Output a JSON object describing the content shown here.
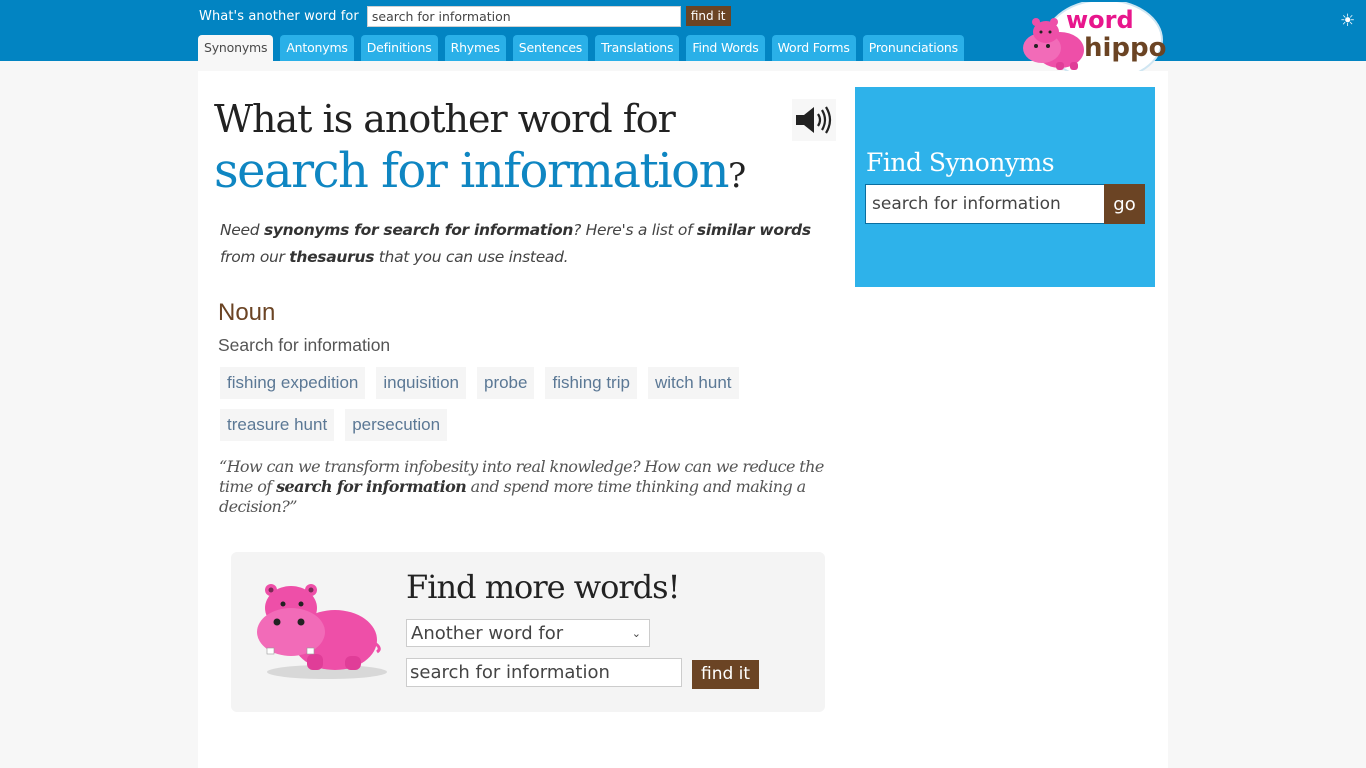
{
  "header": {
    "search_label": "What's another word for",
    "search_value": "search for information",
    "find_button": "find it",
    "tabs": [
      {
        "label": "Synonyms",
        "active": true
      },
      {
        "label": "Antonyms",
        "active": false
      },
      {
        "label": "Definitions",
        "active": false
      },
      {
        "label": "Rhymes",
        "active": false
      },
      {
        "label": "Sentences",
        "active": false
      },
      {
        "label": "Translations",
        "active": false
      },
      {
        "label": "Find Words",
        "active": false
      },
      {
        "label": "Word Forms",
        "active": false
      },
      {
        "label": "Pronunciations",
        "active": false
      }
    ],
    "logo": {
      "word": "word",
      "hippo": "hippo"
    },
    "theme_icon": "sun-icon"
  },
  "main": {
    "title_line1": "What is another word for",
    "title_term": "search for information",
    "title_qmark": "?",
    "speaker_icon": "speaker-icon",
    "intro": {
      "p1": "Need ",
      "b1": "synonyms for search for information",
      "p2": "? Here's a list of ",
      "b2": "similar words",
      "p3": " from our ",
      "b3": "thesaurus",
      "p4": " that you can use instead."
    },
    "part_of_speech": "Noun",
    "sense": "Search for information",
    "synonyms": [
      "fishing expedition",
      "inquisition",
      "probe",
      "fishing trip",
      "witch hunt",
      "treasure hunt",
      "persecution"
    ],
    "quote": {
      "q1": "“How can we transform infobesity into real knowledge? How can we reduce the time of ",
      "qb": "search for information",
      "q2": " and spend more time thinking and making a decision?”"
    },
    "find_more": {
      "title": "Find more words!",
      "select_value": "Another word for",
      "input_value": "search for information",
      "button": "find it"
    }
  },
  "sidebar": {
    "title": "Find Synonyms",
    "input_value": "search for information",
    "go_button": "go"
  },
  "colors": {
    "header_blue": "#0284c2",
    "tab_blue": "#2ab0e8",
    "accent_brown": "#6b4424",
    "title_blue": "#0f86c2",
    "hippo_pink": "#ee4fa8"
  }
}
